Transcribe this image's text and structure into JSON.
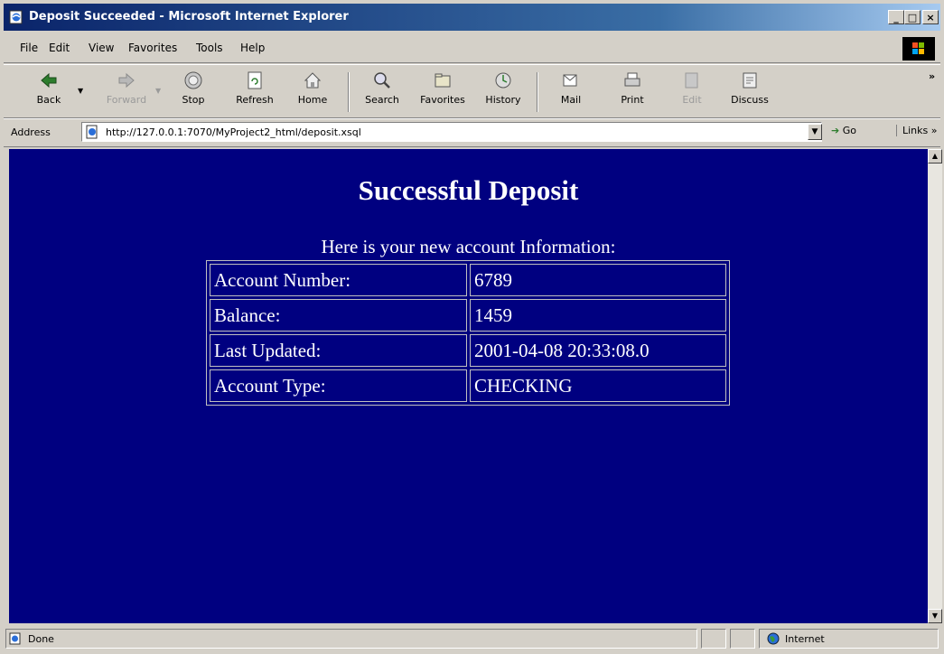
{
  "window": {
    "title": "Deposit Succeeded - Microsoft Internet Explorer",
    "controls": {
      "minimize": "_",
      "maximize": "□",
      "close": "×"
    }
  },
  "menu": [
    "File",
    "Edit",
    "View",
    "Favorites",
    "Tools",
    "Help"
  ],
  "toolbar": {
    "back": "Back",
    "forward": "Forward",
    "stop": "Stop",
    "refresh": "Refresh",
    "home": "Home",
    "search": "Search",
    "favorites": "Favorites",
    "history": "History",
    "mail": "Mail",
    "print": "Print",
    "edit": "Edit",
    "discuss": "Discuss",
    "overflow": "»"
  },
  "address": {
    "label": "Address",
    "url": "http://127.0.0.1:7070/MyProject2_html/deposit.xsql",
    "go": "Go",
    "links": "Links"
  },
  "page": {
    "title": "Successful Deposit",
    "intro": "Here is your new account Information:",
    "rows": [
      {
        "label": "Account Number:",
        "value": "6789"
      },
      {
        "label": "Balance:",
        "value": "1459"
      },
      {
        "label": "Last Updated:",
        "value": "2001-04-08 20:33:08.0"
      },
      {
        "label": "Account Type:",
        "value": "CHECKING"
      }
    ],
    "background": "#000080",
    "text_color": "#ffffff"
  },
  "status": {
    "text": "Done",
    "zone": "Internet"
  }
}
